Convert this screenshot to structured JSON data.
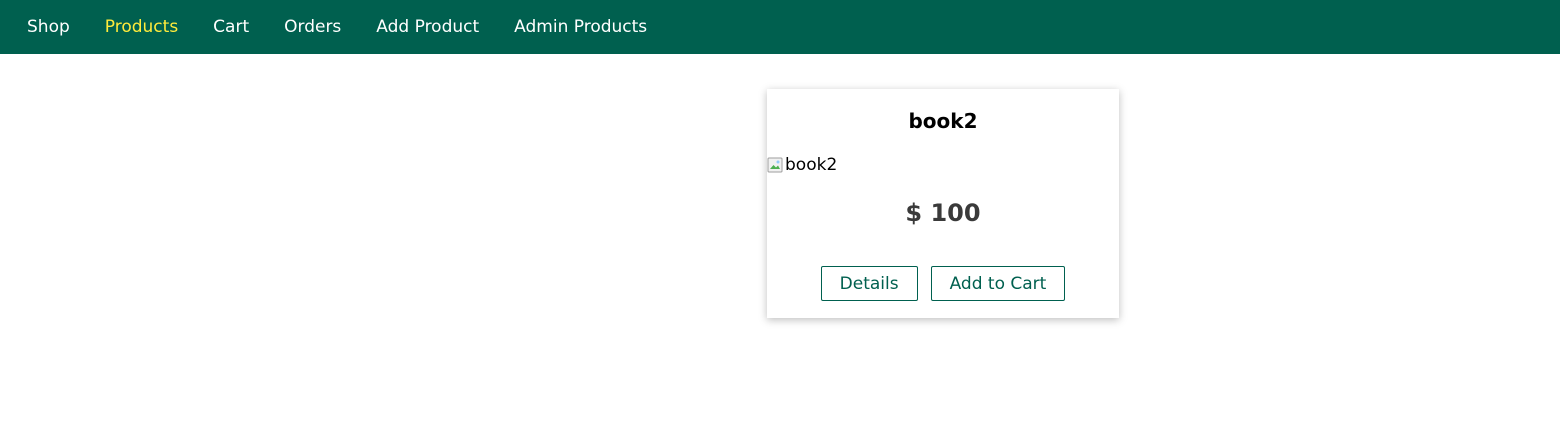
{
  "nav": {
    "items": [
      {
        "label": "Shop",
        "active": false
      },
      {
        "label": "Products",
        "active": true
      },
      {
        "label": "Cart",
        "active": false
      },
      {
        "label": "Orders",
        "active": false
      },
      {
        "label": "Add Product",
        "active": false
      },
      {
        "label": "Admin Products",
        "active": false
      }
    ]
  },
  "product": {
    "title": "book2",
    "image_alt": "book2",
    "price": "$ 100",
    "details_label": "Details",
    "add_to_cart_label": "Add to Cart"
  },
  "colors": {
    "header_bg": "#00604f",
    "nav_text": "#ffffff",
    "nav_active": "#ffeb3b",
    "button_accent": "#00604f",
    "price_text": "#3a3a3a"
  },
  "icons": {
    "image_placeholder": "broken-image-icon"
  }
}
